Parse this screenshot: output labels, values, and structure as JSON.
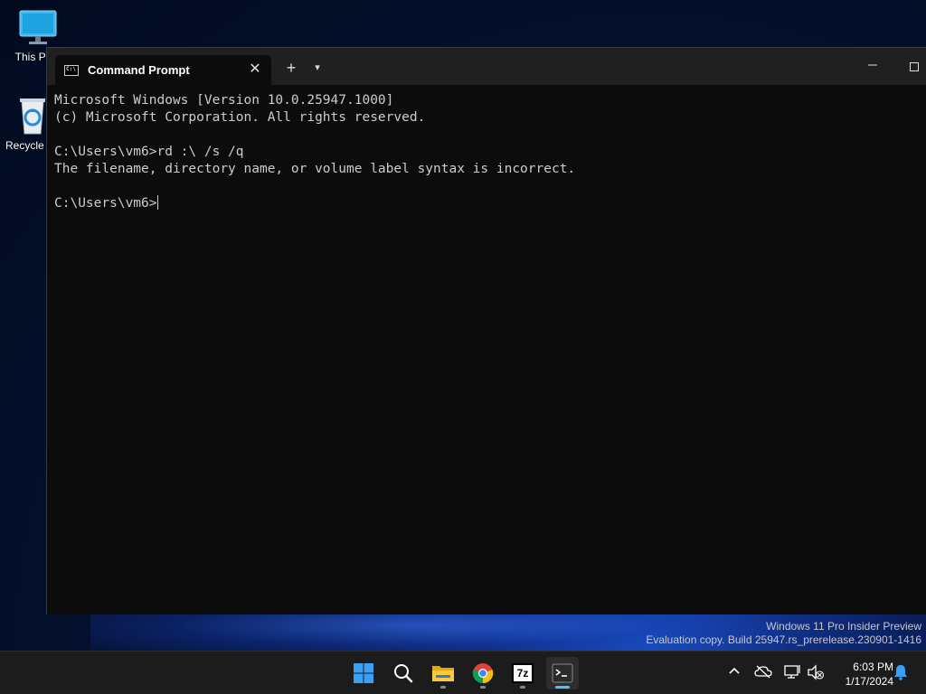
{
  "desktop": {
    "icons": [
      {
        "label": "This PC",
        "icon": "monitor-icon"
      },
      {
        "label": "Recycle Bin",
        "icon": "recycle-bin-icon"
      }
    ]
  },
  "window": {
    "tab_title": "Command Prompt",
    "tab_icon": "cmd-icon",
    "close_glyph": "✕",
    "new_tab_glyph": "+",
    "dropdown_glyph": "▾",
    "minimize_glyph": "—"
  },
  "console": {
    "lines": [
      "Microsoft Windows [Version 10.0.25947.1000]",
      "(c) Microsoft Corporation. All rights reserved.",
      "",
      "C:\\Users\\vm6>rd :\\ /s /q",
      "The filename, directory name, or volume label syntax is incorrect.",
      "",
      "C:\\Users\\vm6>"
    ]
  },
  "watermark": {
    "line1": "Windows 11 Pro Insider Preview",
    "line2": "Evaluation copy. Build 25947.rs_prerelease.230901-1416"
  },
  "taskbar": {
    "apps": [
      {
        "name": "start",
        "icon": "windows-logo-icon"
      },
      {
        "name": "search",
        "icon": "search-icon"
      },
      {
        "name": "file-explorer",
        "icon": "folder-icon"
      },
      {
        "name": "chrome",
        "icon": "chrome-icon"
      },
      {
        "name": "7zip",
        "icon": "7zip-icon",
        "text": "7z"
      },
      {
        "name": "terminal",
        "icon": "terminal-icon"
      }
    ],
    "clock_time": "6:03 PM",
    "clock_date": "1/17/2024"
  },
  "colors": {
    "console_bg": "#0c0c0c",
    "console_text": "#cccccc",
    "taskbar_bg": "#1c1c1c",
    "accent": "#4cc2ff"
  }
}
